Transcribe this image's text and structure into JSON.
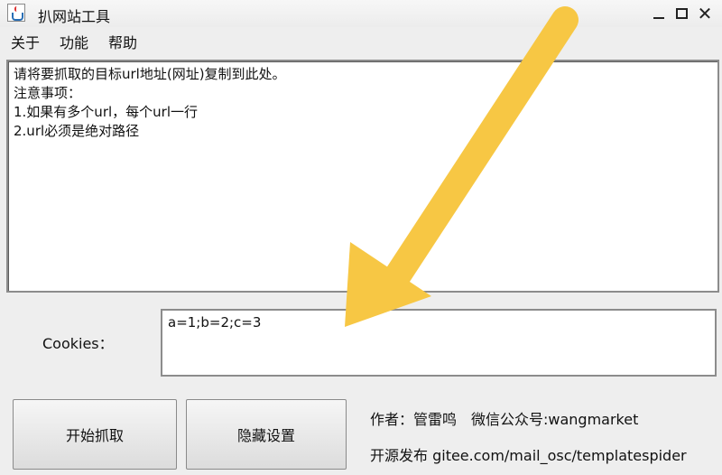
{
  "window": {
    "title": "扒网站工具",
    "close_glyph": "✕"
  },
  "menu": {
    "items": [
      "关于",
      "功能",
      "帮助"
    ]
  },
  "url_area": {
    "lines": [
      "请将要抓取的目标url地址(网址)复制到此处。",
      "注意事项：",
      "1.如果有多个url，每个url一行",
      "2.url必须是绝对路径"
    ]
  },
  "cookies": {
    "label": "Cookies：",
    "value": "a=1;b=2;c=3"
  },
  "buttons": {
    "start": "开始抓取",
    "hide_settings": "隐藏设置"
  },
  "info": {
    "author_line": "作者：管雷鸣　微信公众号:wangmarket",
    "source_line": "开源发布 gitee.com/mail_osc/templatespider"
  },
  "colors": {
    "arrow": "#f7c744"
  }
}
